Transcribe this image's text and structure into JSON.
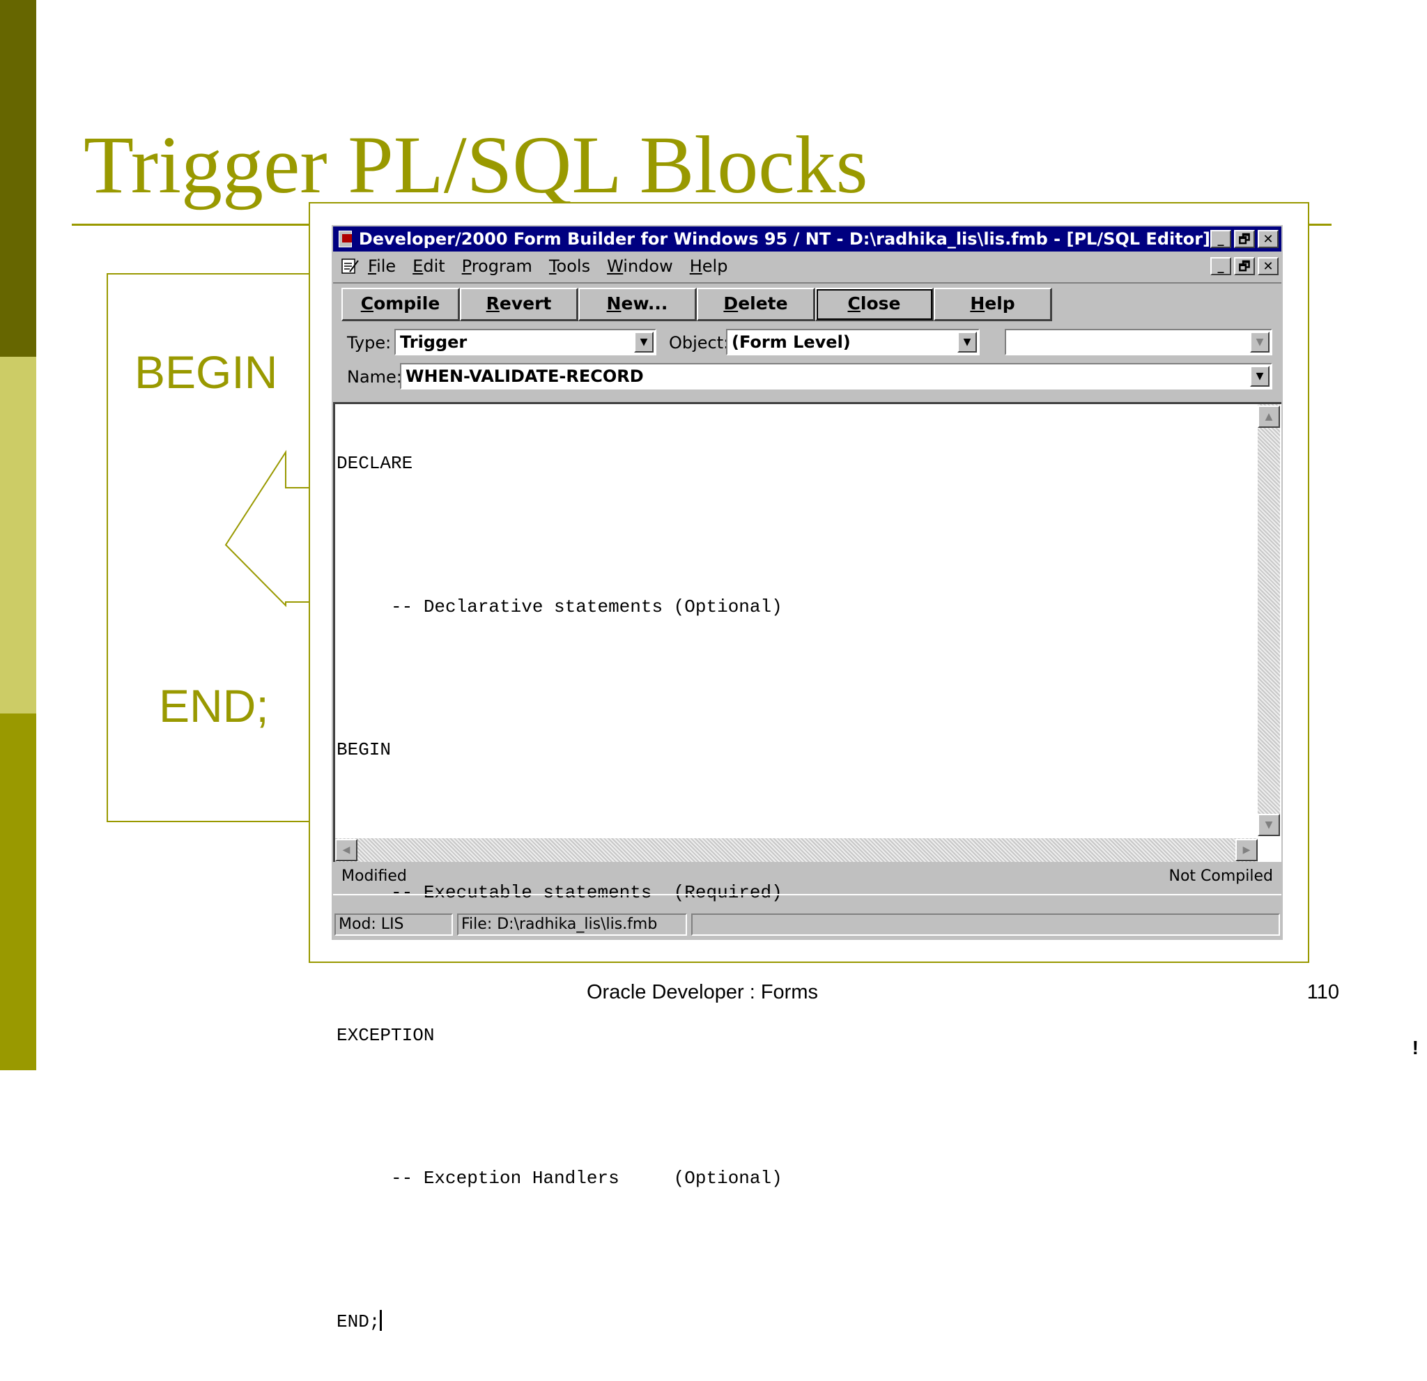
{
  "slide": {
    "title": "Trigger PL/SQL Blocks",
    "begin_label": "BEGIN",
    "end_label": "END;",
    "footer": "Oracle Developer : Forms",
    "page_number": "110",
    "corner_mark": "!",
    "colors": {
      "accent": "#999900",
      "dark_bar": "#666600",
      "light_bar": "#cccc66"
    }
  },
  "window": {
    "title": "Developer/2000 Form Builder for Windows 95 / NT - D:\\radhika_lis\\lis.fmb - [PL/SQL Editor]",
    "minimize": "_",
    "restore": "🗗",
    "close": "✕",
    "title_bg": "#000080"
  },
  "menu": {
    "items": [
      "File",
      "Edit",
      "Program",
      "Tools",
      "Window",
      "Help"
    ]
  },
  "toolbar": {
    "compile": "Compile",
    "revert": "Revert",
    "new": "New...",
    "delete": "Delete",
    "close": "Close",
    "help": "Help"
  },
  "fields": {
    "type_label": "Type:",
    "type_value": "Trigger",
    "object_label": "Object:",
    "object_value": "(Form Level)",
    "object2_value": "",
    "name_label": "Name:",
    "name_value": "WHEN-VALIDATE-RECORD"
  },
  "editor": {
    "lines": [
      "DECLARE",
      "",
      "     -- Declarative statements (Optional)",
      "",
      "BEGIN",
      "",
      "     -- Executable statements  (Required)",
      "",
      "EXCEPTION",
      "",
      "     -- Exception Handlers     (Optional)",
      "",
      "END;"
    ]
  },
  "status": {
    "left": "Modified",
    "right": "Not Compiled",
    "mod": "Mod: LIS",
    "file": "File: D:\\radhika_lis\\lis.fmb",
    "extra": ""
  }
}
